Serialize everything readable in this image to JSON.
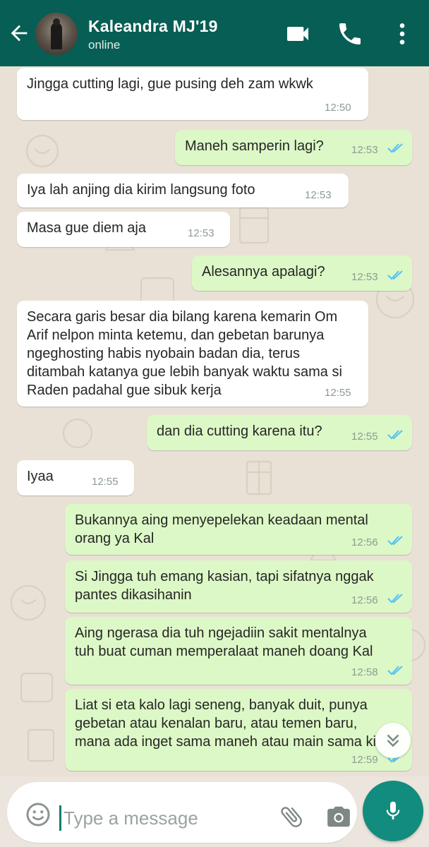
{
  "header": {
    "name": "Kaleandra MJ'19",
    "status": "online"
  },
  "messages": [
    {
      "dir": "in",
      "text": "Jingga cutting lagi, gue pusing deh zam wkwk",
      "time": "12:50"
    },
    {
      "dir": "out",
      "text": "Maneh samperin lagi?",
      "time": "12:53",
      "read": true
    },
    {
      "dir": "in",
      "text": "Iya lah anjing dia kirim langsung foto",
      "time": "12:53"
    },
    {
      "dir": "in",
      "text": "Masa gue diem aja",
      "time": "12:53"
    },
    {
      "dir": "out",
      "text": "Alesannya apalagi?",
      "time": "12:53",
      "read": true
    },
    {
      "dir": "in",
      "text": "Secara garis besar dia bilang karena kemarin Om\nArif nelpon minta ketemu, dan gebetan barunya\nngeghosting habis nyobain badan dia, terus\nditambah katanya gue lebih banyak waktu sama si\nRaden padahal gue sibuk kerja",
      "time": "12:55"
    },
    {
      "dir": "out",
      "text": "dan dia cutting karena itu?",
      "time": "12:55",
      "read": true
    },
    {
      "dir": "in",
      "text": "Iyaa",
      "time": "12:55"
    },
    {
      "dir": "out",
      "text": "Bukannya aing menyepelekan keadaan mental\norang ya Kal",
      "time": "12:56",
      "read": true
    },
    {
      "dir": "out",
      "text": "Si Jingga tuh emang kasian, tapi sifatnya nggak\npantes dikasihanin",
      "time": "12:56",
      "read": true
    },
    {
      "dir": "out",
      "text": "Aing ngerasa dia tuh ngejadiin sakit mentalnya\ntuh buat cuman memperalaat maneh doang Kal",
      "time": "12:58",
      "read": true
    },
    {
      "dir": "out",
      "text": "Liat si eta kalo lagi seneng, banyak duit, punya\ngebetan atau kenalan baru, atau temen baru,\nmana ada inget sama maneh atau main sama ki",
      "time": "12:59",
      "read": true
    }
  ],
  "composer": {
    "placeholder": "Type a message"
  },
  "icons": {
    "back": "arrow-back-icon",
    "video": "video-call-icon",
    "call": "phone-icon",
    "menu": "more-vert-icon",
    "emoji": "emoji-icon",
    "attach": "paperclip-icon",
    "camera": "camera-icon",
    "mic": "mic-icon",
    "scroll": "chevron-double-down-icon",
    "read_receipt": "double-check-icon"
  },
  "colors": {
    "header": "#075e54",
    "outgoing_bubble": "#dcf8c6",
    "incoming_bubble": "#ffffff",
    "read_tick": "#4fc3f7",
    "mic_button": "#128c7e"
  }
}
